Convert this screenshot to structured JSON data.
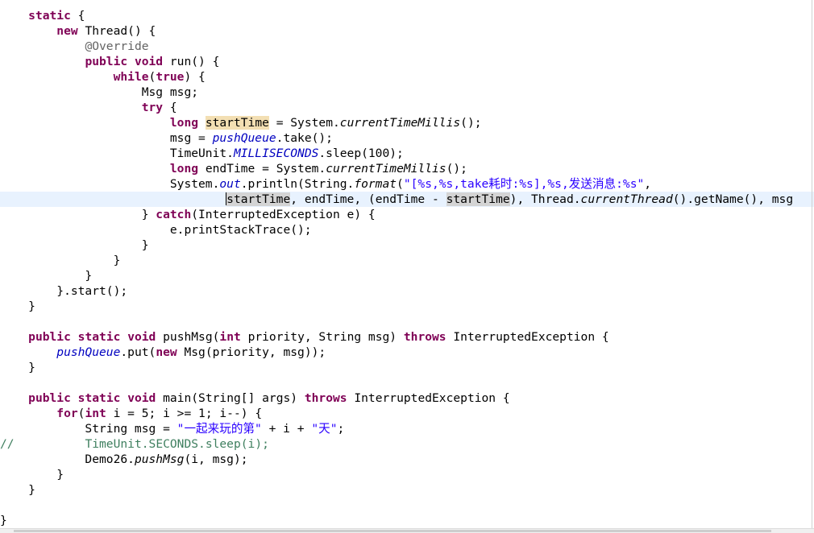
{
  "editor": {
    "comment_prefix": "//",
    "lines": [
      {
        "key": "static"
      },
      {
        "key": "new_thread"
      },
      {
        "key": "override"
      },
      {
        "key": "run"
      },
      {
        "key": "while"
      },
      {
        "key": "msg_decl"
      },
      {
        "key": "try"
      },
      {
        "key": "start_time"
      },
      {
        "key": "take"
      },
      {
        "key": "sleep100"
      },
      {
        "key": "end_time"
      },
      {
        "key": "println"
      },
      {
        "key": "args"
      },
      {
        "key": "catch"
      },
      {
        "key": "print_stack"
      }
    ]
  },
  "strings": {
    "format_string": "\"[%s,%s,take耗时:%s],%s,发送消息:%s\"",
    "msg_string": "\"一起来玩的第\"",
    "day_string": "\"天\""
  },
  "identifiers": {
    "thread_class": "Thread",
    "override": "@Override",
    "start_time": "startTime",
    "end_time": "endTime",
    "push_queue": "pushQueue",
    "current_time_millis": "currentTimeMillis",
    "milliseconds": "MILLISECONDS",
    "out": "out",
    "format": "format",
    "current_thread": "currentThread",
    "push_msg_call": "pushMsg",
    "commented_sleep": "TimeUnit.SECONDS.sleep(i);"
  }
}
